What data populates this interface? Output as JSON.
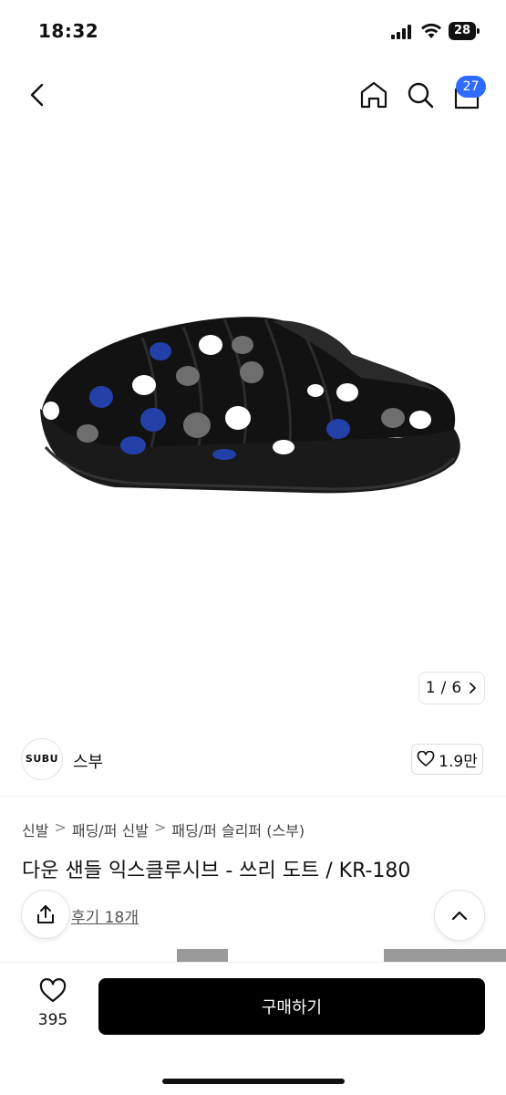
{
  "status_bar": {
    "time": "18:32",
    "battery": "28"
  },
  "nav": {
    "cart_count": "27"
  },
  "gallery": {
    "page_current": "1",
    "page_separator": "/",
    "page_total": "6"
  },
  "brand": {
    "logo_text": "SUBU",
    "name": "스부",
    "like_count": "1.9만"
  },
  "breadcrumb": {
    "items": [
      "신발",
      "패딩/퍼 신발",
      "패딩/퍼 슬리퍼 (스부)"
    ],
    "separator": ">"
  },
  "product": {
    "title": "다운 샌들 익스클루시브 - 쓰리 도트 / KR-180",
    "review_text": "후기 18개"
  },
  "bottom_bar": {
    "like_count": "395",
    "buy_label": "구매하기"
  },
  "colors": {
    "badge": "#2f6bff",
    "buy_button": "#000000",
    "dot_blue": "#2340a8",
    "dot_gray": "#6e6e6e",
    "dot_white": "#ffffff"
  }
}
